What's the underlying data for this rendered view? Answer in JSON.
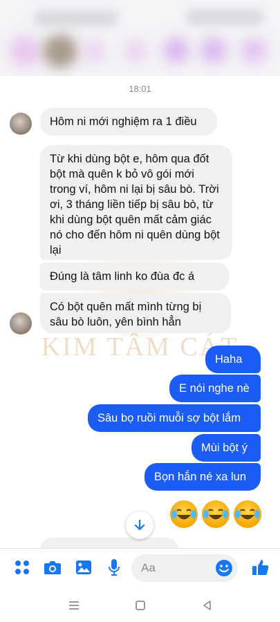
{
  "conversation": {
    "timestamp": "18:01",
    "watermark": "KIM TÂM CÁT",
    "incoming": [
      "Hôm ni mới nghiệm ra 1 điều",
      "Từ khi dùng bột e, hôm qua đốt bột mà quên k bỏ vô gói mới trong ví, hôm ni lại bị sâu bò. Trời ơi, 3 tháng liền tiếp bị sâu bò, từ khi dùng bột quên mất cảm giác nó cho đến hôm ni quên dùng bột lại",
      "Đúng là tâm linh ko đùa đc á",
      "Có bột quên mất mình từng bị sâu bò luôn, yên bình hẳn"
    ],
    "outgoing": [
      "Haha",
      "E nói nghe nè",
      "Sâu bọ ruồi muỗi sợ bột lắm",
      "Mùi bột ý",
      "Bọn hắn né xa lun"
    ],
    "reactions": [
      "laughing-tears-emoji",
      "laughing-tears-emoji",
      "laughing-tears-emoji"
    ]
  },
  "composer": {
    "placeholder": "Aa",
    "icons": [
      "menu-dots-icon",
      "camera-icon",
      "gallery-icon",
      "microphone-icon",
      "emoji-icon",
      "thumbs-up-icon"
    ]
  },
  "colors": {
    "accent": "#1b5cf5",
    "incoming_bubble": "#f0f0f0",
    "toolbar_icon": "#1877f2"
  }
}
